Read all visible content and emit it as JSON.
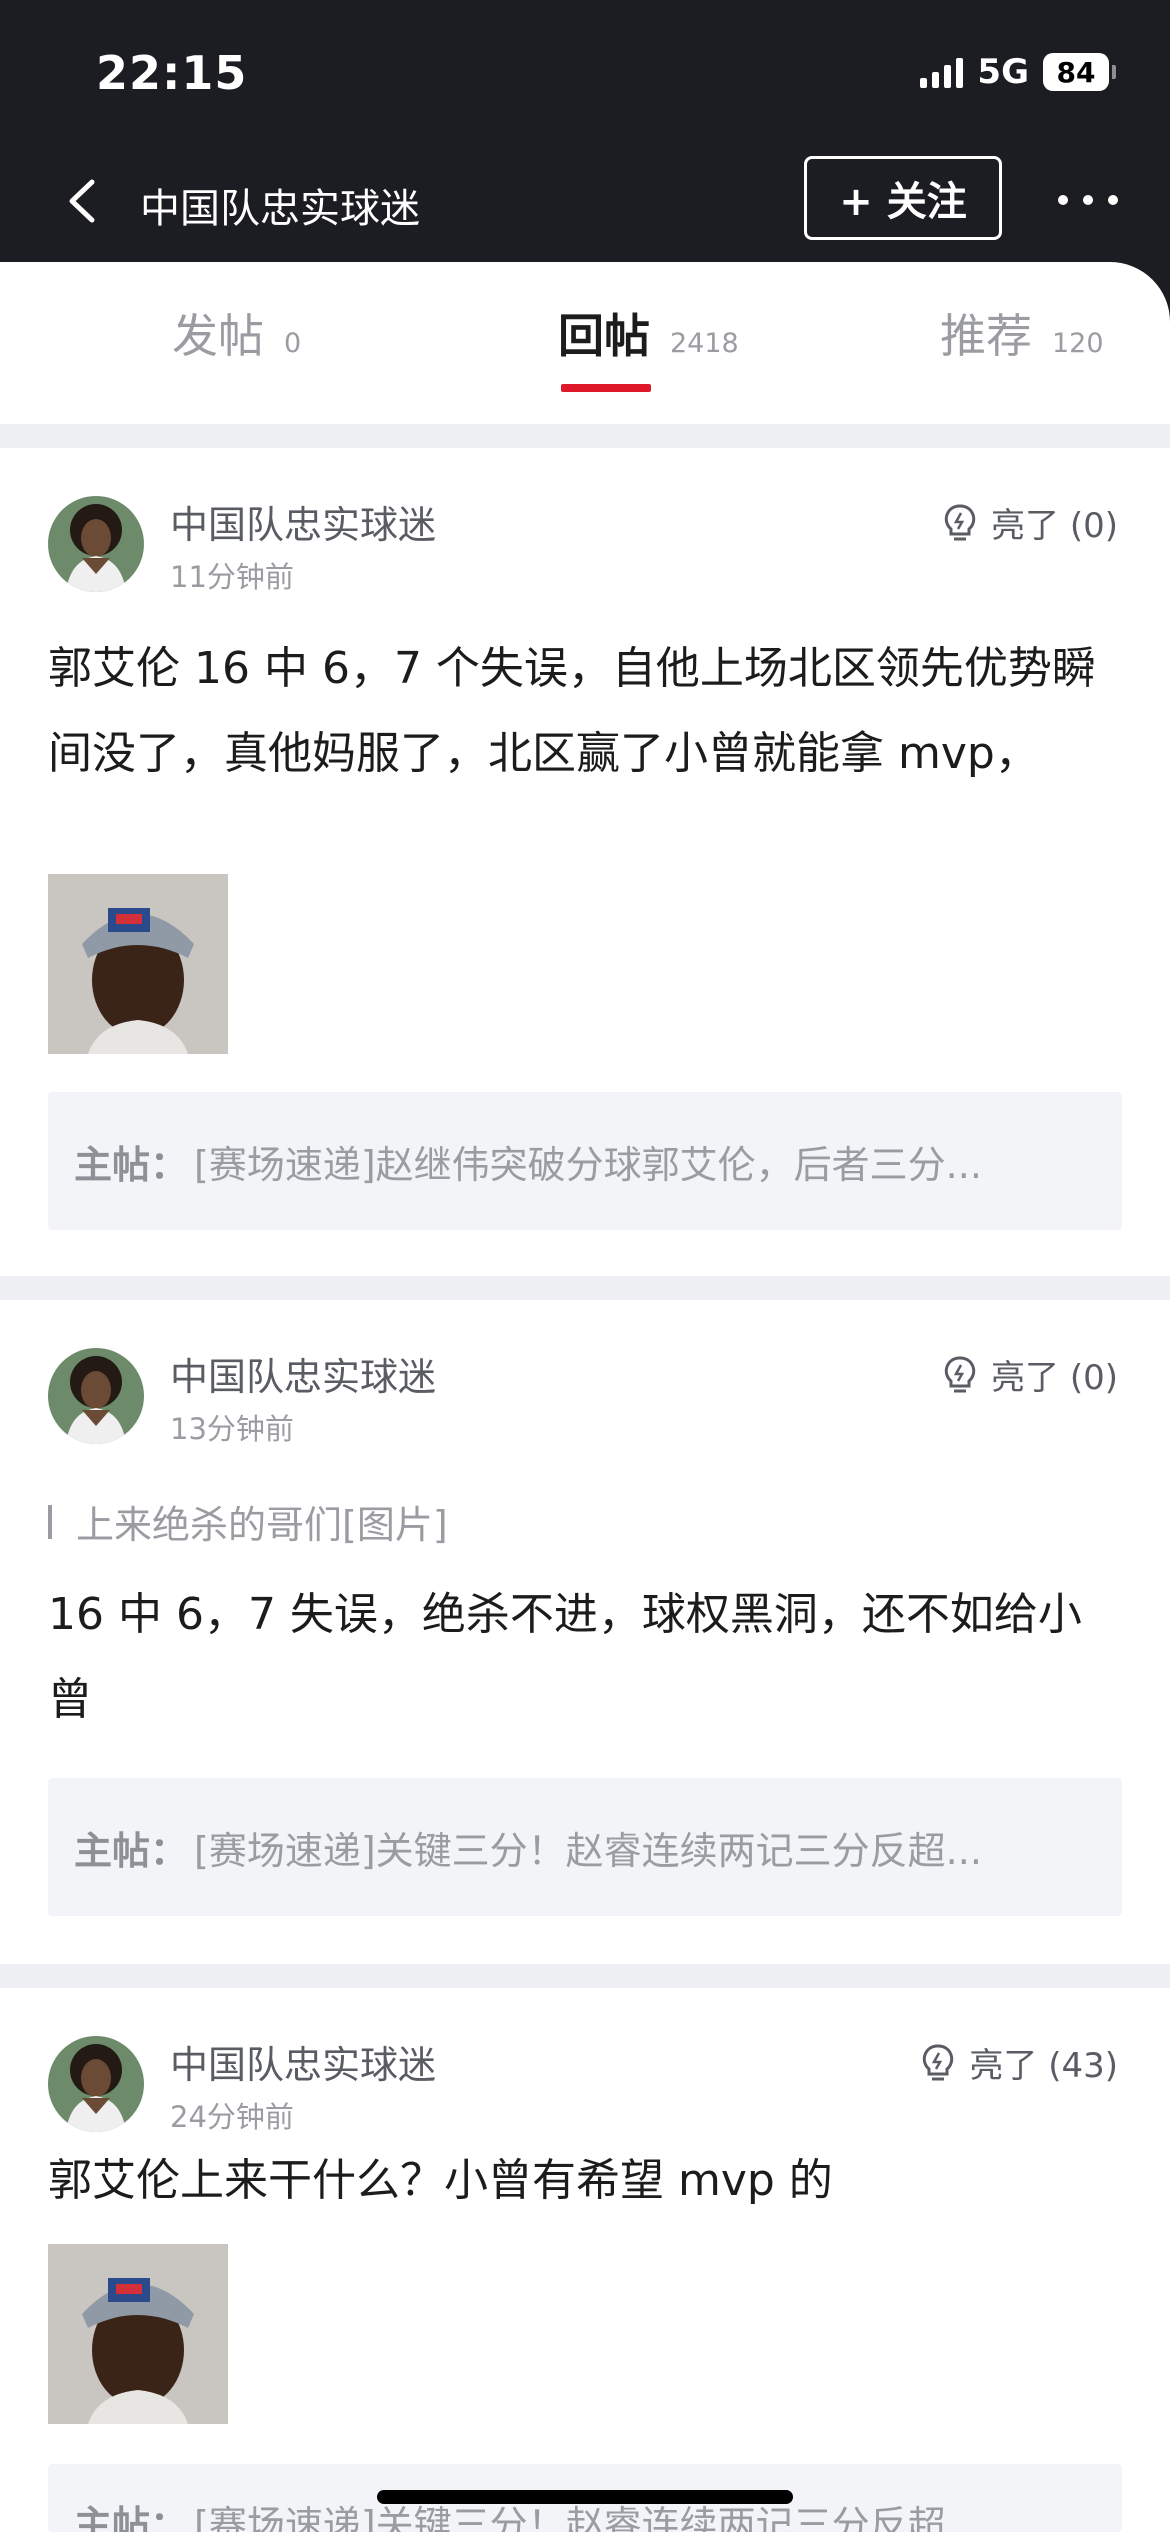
{
  "status_bar": {
    "time": "22:15",
    "network": "5G",
    "battery": "84"
  },
  "header": {
    "title": "中国队忠实球迷",
    "follow_label": "+ 关注"
  },
  "tabs": [
    {
      "label": "发帖",
      "count": "0"
    },
    {
      "label": "回帖",
      "count": "2418"
    },
    {
      "label": "推荐",
      "count": "120"
    }
  ],
  "posts": [
    {
      "author": "中国队忠实球迷",
      "time": "11分钟前",
      "like": "亮了 (0)",
      "content": "郭艾伦 16 中 6，7 个失误，自他上场北区领先优势瞬间没了，真他妈服了，北区赢了小曾就能拿 mvp，",
      "main_post_label": "主帖：",
      "main_post_text": "[赛场速递]赵继伟突破分球郭艾伦，后者三分..."
    },
    {
      "author": "中国队忠实球迷",
      "time": "13分钟前",
      "like": "亮了 (0)",
      "quote": "上来绝杀的哥们[图片]",
      "content": "16 中 6，7 失误，绝杀不进，球权黑洞，还不如给小曾",
      "main_post_label": "主帖：",
      "main_post_text": "[赛场速递]关键三分！赵睿连续两记三分反超..."
    },
    {
      "author": "中国队忠实球迷",
      "time": "24分钟前",
      "like": "亮了 (43)",
      "content": "郭艾伦上来干什么？小曾有希望 mvp 的",
      "main_post_label": "主帖：",
      "main_post_text": "[赛场速递]关键三分！赵睿连续两记三分反超..."
    }
  ],
  "colors": {
    "header_bg": "#1c1d22",
    "accent": "#e0192a",
    "muted": "#9a9ca2",
    "quote_bg": "#f3f4f7"
  }
}
